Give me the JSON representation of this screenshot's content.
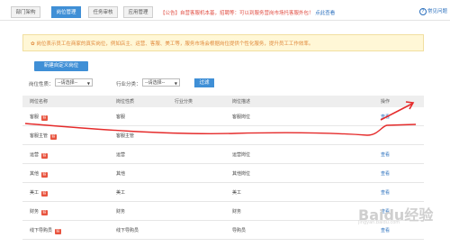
{
  "tabs": [
    {
      "label": "部门架构",
      "active": false
    },
    {
      "label": "岗位管理",
      "active": true
    },
    {
      "label": "任务审核",
      "active": false
    },
    {
      "label": "应用管理",
      "active": false
    }
  ],
  "notice": {
    "text": "【公告】自营客服机本基，招聘等：可以到服务营岗市场托客服外包！",
    "link": "点此查看"
  },
  "help": {
    "icon": "question-icon",
    "label": "常见问题"
  },
  "info": {
    "text": "✿ 岗位表示员工在商家的真实岗位，例如店主、运营、客服、美工等，服务市场会根据岗位提供个性化服务，提升员工工作效率。"
  },
  "add_button": "新建自定义岗位",
  "filters": {
    "type_label": "岗位性质：",
    "type_value": "--请选择--",
    "category_label": "行业分类：",
    "category_value": "--请选择--",
    "search_button": "过滤"
  },
  "table": {
    "headers": [
      "岗位名称",
      "岗位性质",
      "行业分类",
      "岗位描述",
      "操作"
    ],
    "rows": [
      {
        "name": "客服",
        "badge": "官",
        "type": "客服",
        "category": "",
        "desc": "客服岗位",
        "action": "查看"
      },
      {
        "name": "客服主管",
        "badge": "官",
        "type": "客服主管",
        "category": "",
        "desc": "",
        "action": ""
      },
      {
        "name": "运营",
        "badge": "官",
        "type": "运营",
        "category": "",
        "desc": "运营岗位",
        "action": "查看"
      },
      {
        "name": "其他",
        "badge": "官",
        "type": "其他",
        "category": "",
        "desc": "其他岗位",
        "action": "查看"
      },
      {
        "name": "美工",
        "badge": "官",
        "type": "美工",
        "category": "",
        "desc": "美工",
        "action": "查看"
      },
      {
        "name": "财务",
        "badge": "官",
        "type": "财务",
        "category": "",
        "desc": "财务",
        "action": "查看"
      },
      {
        "name": "线下导购员",
        "badge": "官",
        "type": "线下导购员",
        "category": "",
        "desc": "导购员",
        "action": "查看"
      }
    ]
  },
  "watermark": {
    "main": "Baidu经验",
    "sub": "jingyan.baidu.com"
  },
  "colors": {
    "accent": "#3f8fd6",
    "notice": "#e04a3f",
    "annotation": "#e52b2b",
    "badge": "#e8543f"
  }
}
